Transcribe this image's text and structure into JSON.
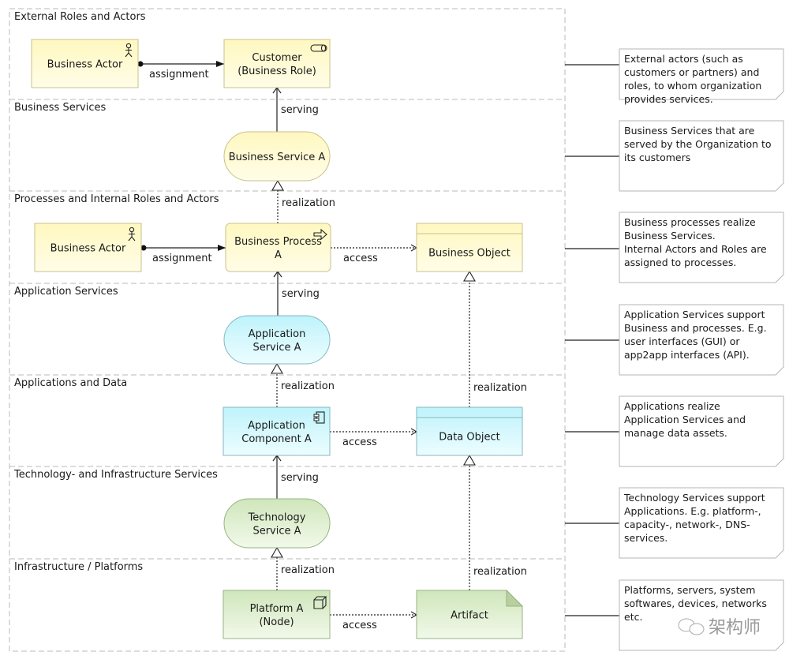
{
  "lanes": [
    {
      "label": "External Roles and Actors"
    },
    {
      "label": "Business Services"
    },
    {
      "label": "Processes and Internal Roles and Actors"
    },
    {
      "label": "Application Services"
    },
    {
      "label": "Applications and Data"
    },
    {
      "label": "Technology- and Infrastructure Services"
    },
    {
      "label": "Infrastructure / Platforms"
    }
  ],
  "elements": {
    "business_actor_ext": {
      "lines": [
        "Business Actor"
      ],
      "type": "business-actor",
      "icon": "actor-icon"
    },
    "customer": {
      "lines": [
        "Customer",
        "(Business Role)"
      ],
      "type": "business-role",
      "icon": "role-icon"
    },
    "business_service": {
      "lines": [
        "Business Service A"
      ],
      "type": "business-service"
    },
    "business_actor_int": {
      "lines": [
        "Business Actor"
      ],
      "type": "business-actor",
      "icon": "actor-icon"
    },
    "business_process": {
      "lines": [
        "Business Process",
        "A"
      ],
      "type": "business-process",
      "icon": "process-arrow-icon"
    },
    "business_object": {
      "lines": [
        "Business Object"
      ],
      "type": "business-object"
    },
    "application_service": {
      "lines": [
        "Application",
        "Service A"
      ],
      "type": "application-service"
    },
    "application_component": {
      "lines": [
        "Application",
        "Component A"
      ],
      "type": "application-component",
      "icon": "component-icon"
    },
    "data_object": {
      "lines": [
        "Data Object"
      ],
      "type": "data-object"
    },
    "technology_service": {
      "lines": [
        "Technology",
        "Service A"
      ],
      "type": "technology-service"
    },
    "platform": {
      "lines": [
        "Platform A",
        "(Node)"
      ],
      "type": "node",
      "icon": "node-cube-icon"
    },
    "artifact": {
      "lines": [
        "Artifact"
      ],
      "type": "artifact"
    }
  },
  "relations": [
    {
      "label": "assignment",
      "type": "assignment",
      "from": "business_actor_ext",
      "to": "customer"
    },
    {
      "label": "serving",
      "type": "serving",
      "from": "business_service",
      "to": "customer"
    },
    {
      "label": "realization",
      "type": "realization",
      "from": "business_process",
      "to": "business_service"
    },
    {
      "label": "assignment",
      "type": "assignment",
      "from": "business_actor_int",
      "to": "business_process"
    },
    {
      "label": "access",
      "type": "access",
      "from": "business_process",
      "to": "business_object"
    },
    {
      "label": "serving",
      "type": "serving",
      "from": "application_service",
      "to": "business_process"
    },
    {
      "label": "realization",
      "type": "realization",
      "from": "application_component",
      "to": "application_service"
    },
    {
      "label": "access",
      "type": "access",
      "from": "application_component",
      "to": "data_object"
    },
    {
      "label": "realization",
      "type": "realization",
      "from": "data_object",
      "to": "business_object"
    },
    {
      "label": "serving",
      "type": "serving",
      "from": "technology_service",
      "to": "application_component"
    },
    {
      "label": "realization",
      "type": "realization",
      "from": "platform",
      "to": "technology_service"
    },
    {
      "label": "access",
      "type": "access",
      "from": "platform",
      "to": "artifact"
    },
    {
      "label": "realization",
      "type": "realization",
      "from": "artifact",
      "to": "data_object"
    }
  ],
  "notes": [
    {
      "lines": [
        "External actors (such as",
        "customers or partners) and",
        "roles, to whom organization",
        "provides services."
      ]
    },
    {
      "lines": [
        "Business Services that are",
        "served by the Organization to",
        "its customers"
      ]
    },
    {
      "lines": [
        "Business processes realize",
        "Business Services.",
        "Internal Actors and Roles are",
        "assigned to processes."
      ]
    },
    {
      "lines": [
        "Application Services support",
        "Business and processes. E.g.",
        "user interfaces (GUI) or",
        "app2app interfaces (API)."
      ]
    },
    {
      "lines": [
        "Applications realize",
        "Application Services and",
        "manage data assets."
      ]
    },
    {
      "lines": [
        "Technology Services support",
        "Applications. E.g. platform-,",
        "capacity-, network-, DNS-",
        "services."
      ]
    },
    {
      "lines": [
        "Platforms, servers, system",
        "softwares, devices, networks",
        "etc."
      ]
    }
  ],
  "watermark": "架构师",
  "colors": {
    "business": "#fffbc6",
    "business_border": "#c8c08a",
    "application": "#c4f6fc",
    "application_border": "#86b7c0",
    "technology": "#d6ebc3",
    "technology_border": "#98b381",
    "lane_border": "#b9b9b9",
    "note_border": "#b5b5b5"
  }
}
